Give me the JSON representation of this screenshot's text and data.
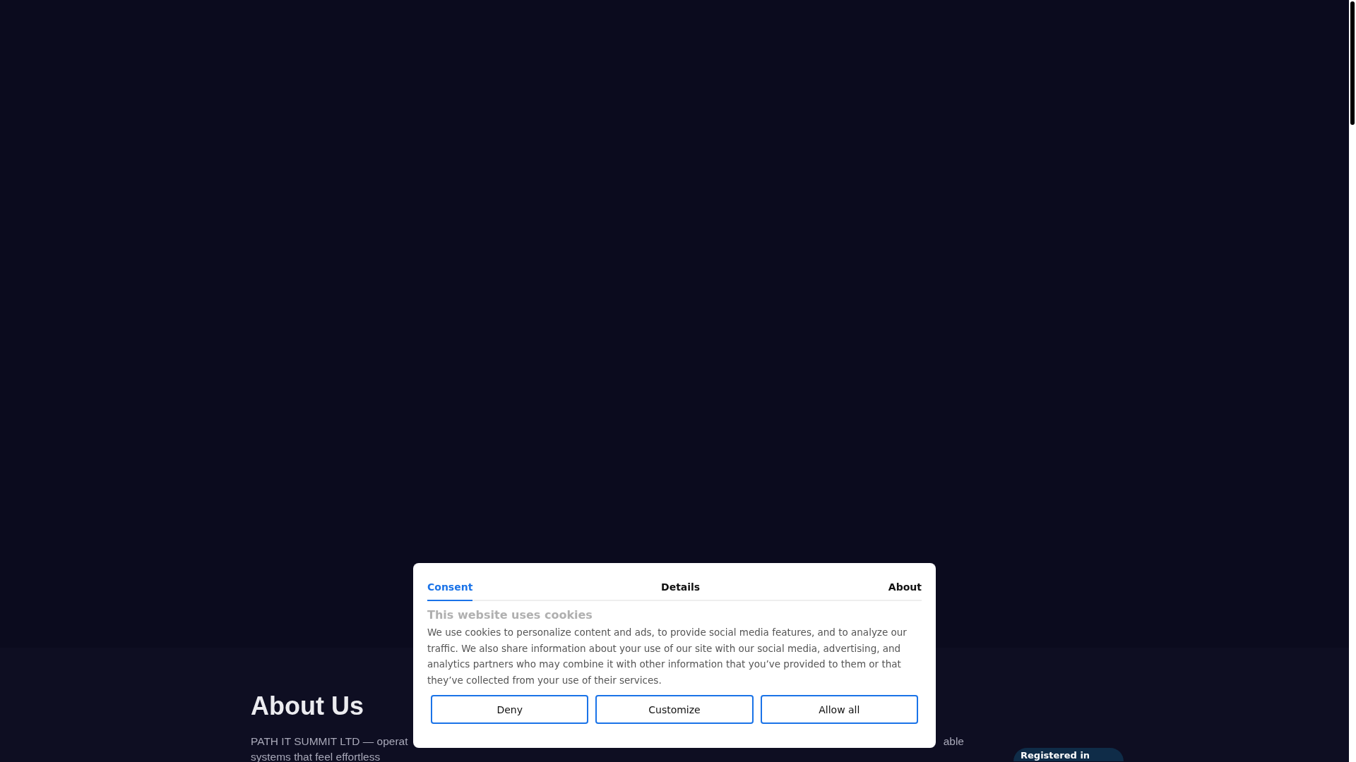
{
  "about": {
    "title": "About Us",
    "line_1_start": "PATH IT SUMMIT LTD — operat",
    "line_1_end": "able",
    "line_2": "systems that feel effortless",
    "badge": "Registered in"
  },
  "cookie_dialog": {
    "tabs": [
      {
        "label": "Consent",
        "selected": true
      },
      {
        "label": "Details",
        "selected": false
      },
      {
        "label": "About",
        "selected": false
      }
    ],
    "heading": "This website uses cookies",
    "body": "We use cookies to personalize content and ads, to provide social media features, and to analyze our traffic. We also share information about your use of our site with our social media, advertising, and analytics partners who may combine it with other information that you’ve provided to them or that they’ve collected from your use of their services.",
    "buttons": [
      "Deny",
      "Customize",
      "Allow all"
    ]
  }
}
